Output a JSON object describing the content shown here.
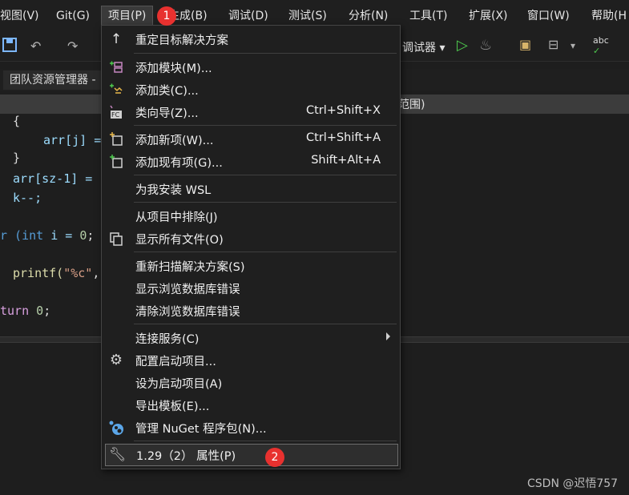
{
  "menubar": {
    "items": [
      {
        "label": "视图(V)"
      },
      {
        "label": "Git(G)"
      },
      {
        "label": "项目(P)"
      },
      {
        "label": "生成(B)"
      },
      {
        "label": "调试(D)"
      },
      {
        "label": "测试(S)"
      },
      {
        "label": "分析(N)"
      },
      {
        "label": "工具(T)"
      },
      {
        "label": "扩展(X)"
      },
      {
        "label": "窗口(W)"
      },
      {
        "label": "帮助(H"
      }
    ]
  },
  "toolbar": {
    "debugger_label": "调试器 ▾"
  },
  "team_explorer_tab": "团队资源管理器 -",
  "doc_scope_fragment": "范围)",
  "code": {
    "line1": "{",
    "line2": "arr[j] =",
    "line3": "}",
    "line4": "arr[sz-1] =",
    "line5": "k--;",
    "line6a": "r (",
    "line6b": "int",
    "line6c": " i = ",
    "line6d": "0",
    "line6e": ";",
    "line7a": "printf(",
    "line7b": "\"%c\"",
    "line7c": ",",
    "line8a": "turn ",
    "line8b": "0",
    "line8c": ";"
  },
  "menu": {
    "items": [
      {
        "label": "重定目标解决方案",
        "shortcut": "",
        "icon": "up-arrow-icon"
      },
      {
        "label": "添加模块(M)...",
        "shortcut": "",
        "icon": "add-module-icon"
      },
      {
        "label": "添加类(C)...",
        "shortcut": "",
        "icon": "add-class-icon"
      },
      {
        "label": "类向导(Z)...",
        "shortcut": "Ctrl+Shift+X",
        "icon": "class-wizard-icon"
      },
      {
        "label": "添加新项(W)...",
        "shortcut": "Ctrl+Shift+A",
        "icon": "add-new-item-icon"
      },
      {
        "label": "添加现有项(G)...",
        "shortcut": "Shift+Alt+A",
        "icon": "add-existing-item-icon"
      },
      {
        "label": "为我安装 WSL",
        "shortcut": "",
        "icon": ""
      },
      {
        "label": "从项目中排除(J)",
        "shortcut": "",
        "icon": ""
      },
      {
        "label": "显示所有文件(O)",
        "shortcut": "",
        "icon": "show-all-files-icon"
      },
      {
        "label": "重新扫描解决方案(S)",
        "shortcut": "",
        "icon": ""
      },
      {
        "label": "显示浏览数据库错误",
        "shortcut": "",
        "icon": ""
      },
      {
        "label": "清除浏览数据库错误",
        "shortcut": "",
        "icon": ""
      },
      {
        "label": "连接服务(C)",
        "shortcut": "",
        "icon": ""
      },
      {
        "label": "配置启动项目...",
        "shortcut": "",
        "icon": "gear-icon"
      },
      {
        "label": "设为启动项目(A)",
        "shortcut": "",
        "icon": ""
      },
      {
        "label": "导出模板(E)...",
        "shortcut": "",
        "icon": ""
      },
      {
        "label": "管理 NuGet 程序包(N)...",
        "shortcut": "",
        "icon": "nuget-icon"
      },
      {
        "label": "1.29（2） 属性(P)",
        "shortcut": "",
        "icon": "wrench-icon"
      }
    ]
  },
  "annotations": {
    "badge1": "1",
    "badge2": "2"
  },
  "watermark": "CSDN @迟悟757",
  "colors": {
    "accent_badge": "#e8312f",
    "menu_bg": "#1f1f1f",
    "keyword": "#569cd6"
  }
}
